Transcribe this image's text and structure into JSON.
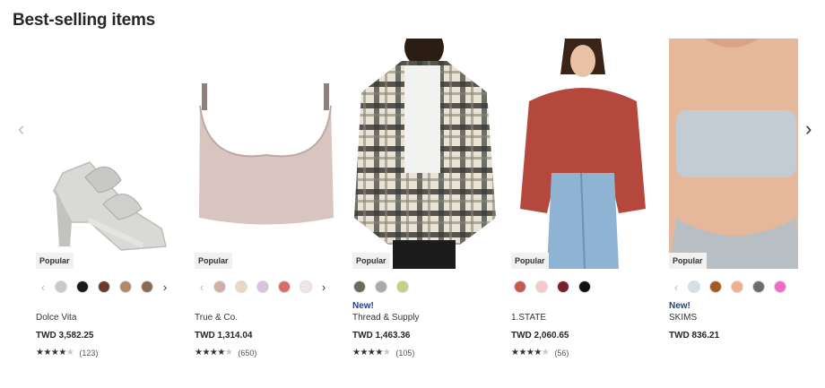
{
  "section": {
    "title": "Best-selling items"
  },
  "nav": {
    "prev_icon": "‹",
    "next_icon": "›"
  },
  "products": [
    {
      "brand": "Dolce Vita",
      "price": "TWD 3,582.25",
      "badge": "Popular",
      "new_label": "",
      "rating": 4.5,
      "stars": "★★★★",
      "half": "★",
      "off": "",
      "count": "(123)",
      "swatches": [
        "#c9c9c6",
        "#1a1a1a",
        "#6b3b2a",
        "#b08a6a",
        "#8a6a55"
      ],
      "has_arrows": true
    },
    {
      "brand": "True & Co.",
      "price": "TWD 1,314.04",
      "badge": "Popular",
      "new_label": "",
      "rating": 4.5,
      "stars": "★★★★",
      "half": "★",
      "off": "",
      "count": "(650)",
      "swatches": [
        "#cdb1a8",
        "#ecd6c0",
        "#d9c3df",
        "#d96b6b",
        "#f3e3ea"
      ],
      "has_arrows": true
    },
    {
      "brand": "Thread & Supply",
      "price": "TWD 1,463.36",
      "badge": "Popular",
      "new_label": "New!",
      "rating": 4,
      "stars": "★★★★",
      "half": "",
      "off": "★",
      "count": "(105)",
      "swatches": [
        "#6f6a5d",
        "#a9a9a9",
        "#c9cd86"
      ],
      "has_arrows": false
    },
    {
      "brand": "1.STATE",
      "price": "TWD 2,060.65",
      "badge": "Popular",
      "new_label": "",
      "rating": 4,
      "stars": "★★★★",
      "half": "",
      "off": "★",
      "count": "(56)",
      "swatches": [
        "#c45a50",
        "#f3c9cc",
        "#7a1f2e",
        "#111111"
      ],
      "has_arrows": false
    },
    {
      "brand": "SKIMS",
      "price": "TWD 836.21",
      "badge": "Popular",
      "new_label": "New!",
      "rating": 0,
      "stars": "",
      "half": "",
      "off": "",
      "count": "",
      "swatches": [
        "#d6dfe6",
        "#a65a22",
        "#f0b08e",
        "#6a6f65",
        "#f06ac9"
      ],
      "has_arrows": true
    }
  ]
}
